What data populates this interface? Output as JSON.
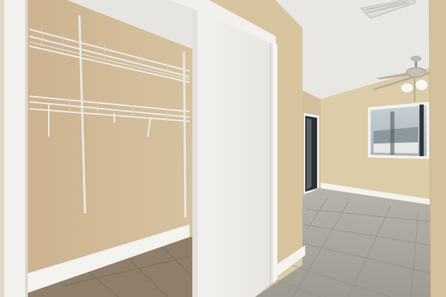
{
  "scene": {
    "description_visible_text": [],
    "colors": {
      "wall_tan": "#d8c49f",
      "wall_shadow": "#c7b08a",
      "closet_wall": "#cdb48f",
      "trim_white": "#f4f3ef",
      "ceiling": "#e9e8e4",
      "floor_tile": "#a9a49c",
      "floor_grout": "#8f8a82",
      "closet_floor": "#8b7b68",
      "door_white": "#f1f0ec",
      "window_sky": "#b9c3cc",
      "fan_metal": "#c8c2b8"
    },
    "objects": [
      {
        "name": "left-door-frame"
      },
      {
        "name": "closet-interior"
      },
      {
        "name": "wire-shelf-upper"
      },
      {
        "name": "wire-shelf-lower"
      },
      {
        "name": "sliding-closet-door"
      },
      {
        "name": "hallway-wall"
      },
      {
        "name": "textured-ceiling"
      },
      {
        "name": "ceiling-vent"
      },
      {
        "name": "ceiling-fan"
      },
      {
        "name": "window"
      },
      {
        "name": "dark-doorway"
      },
      {
        "name": "tile-floor"
      },
      {
        "name": "baseboard"
      },
      {
        "name": "right-wall-edge"
      }
    ]
  }
}
